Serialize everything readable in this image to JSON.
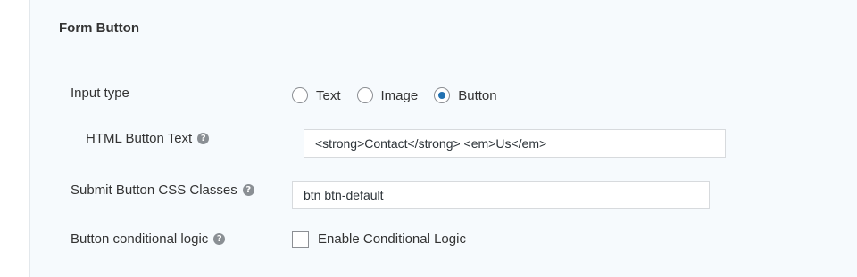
{
  "section": {
    "title": "Form Button"
  },
  "input_type": {
    "label": "Input type",
    "options": [
      {
        "label": "Text",
        "selected": false
      },
      {
        "label": "Image",
        "selected": false
      },
      {
        "label": "Button",
        "selected": true
      }
    ]
  },
  "html_button_text": {
    "label": "HTML Button Text",
    "value": "<strong>Contact</strong> <em>Us</em>",
    "help_icon": "question-circle-icon"
  },
  "css_classes": {
    "label": "Submit Button CSS Classes",
    "value": "btn btn-default",
    "help_icon": "question-circle-icon"
  },
  "conditional_logic": {
    "label": "Button conditional logic",
    "checkbox_label": "Enable Conditional Logic",
    "checked": false,
    "help_icon": "question-circle-icon"
  },
  "colors": {
    "panel_background": "#f6fafd",
    "radio_selected": "#2271b1",
    "help_icon": "#8a8f94"
  }
}
